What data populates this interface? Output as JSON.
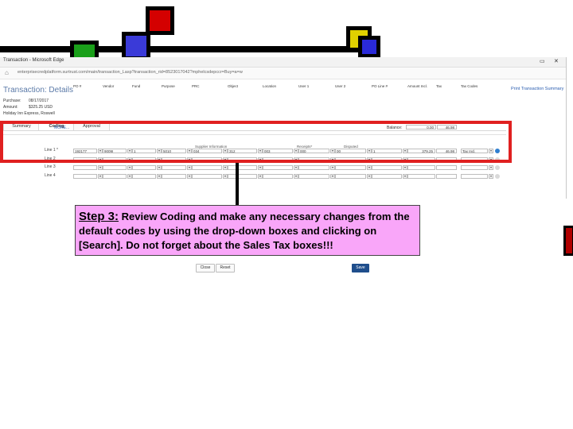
{
  "window": {
    "title": "Transaction - Microsoft Edge",
    "url": "enterprisecredplatform.surtrust.com/main/transaction_Lasp?transaction_rid=8523017042?mphelcsdepccr=Buy=a=w"
  },
  "page": {
    "heading": "Transaction: Details",
    "print_link": "Print Transaction Summary",
    "meta": [
      {
        "label": "Purchase:",
        "value": "08/17/2017"
      },
      {
        "label": "Amount:",
        "value": "$325.25 USD"
      },
      {
        "label": "Holiday Inn Express, Roswell",
        "value": ""
      }
    ]
  },
  "tabs": [
    "Summary",
    "Coding",
    "Approval"
  ],
  "active_tab": "Coding",
  "grid": {
    "columns": [
      "PO #",
      "Vendor",
      "Fund",
      "Purpose",
      "PRC",
      "Object",
      "Location",
      "User 1",
      "User 2",
      "PO Line #",
      "Amount Incl.",
      "Tax",
      "Tax Codes"
    ],
    "rows": [
      {
        "label": "Line 1 *",
        "values": [
          "192177",
          "9009I",
          "1",
          "5010",
          "034",
          "312",
          "003",
          "000",
          "00",
          "1",
          "379.25",
          "46.98",
          "Tax Incl."
        ]
      },
      {
        "label": "Line 2",
        "values": [
          "",
          "",
          "",
          "",
          "",
          "",
          "",
          "",
          "",
          "",
          "",
          "",
          ""
        ]
      },
      {
        "label": "Line 3",
        "values": [
          "",
          "",
          "",
          "",
          "",
          "",
          "",
          "",
          "",
          "",
          "",
          "",
          ""
        ]
      },
      {
        "label": "Line 4",
        "values": [
          "",
          "",
          "",
          "",
          "",
          "",
          "",
          "",
          "",
          "",
          "",
          "",
          ""
        ]
      }
    ],
    "more_link": "MORE...",
    "balance_label": "Balance:",
    "balance_values": [
      "0.00",
      "46.98"
    ]
  },
  "lower_form": {
    "supplier_info": "Supplier Information",
    "receipts": "Receipts*",
    "disputed": "Disputed",
    "close_label": "Close",
    "reset_label": "Reset",
    "save_label": "Save"
  },
  "callout": {
    "step": "Step 3:",
    "text": " Review Coding and make any necessary changes from the default codes by using the drop-down boxes and clicking on [Search].  Do not forget about the Sales Tax boxes!!!"
  },
  "colors": {
    "highlight": "#e02020",
    "callout_bg": "#f9a6f9",
    "accent": "#1f4e8c"
  }
}
